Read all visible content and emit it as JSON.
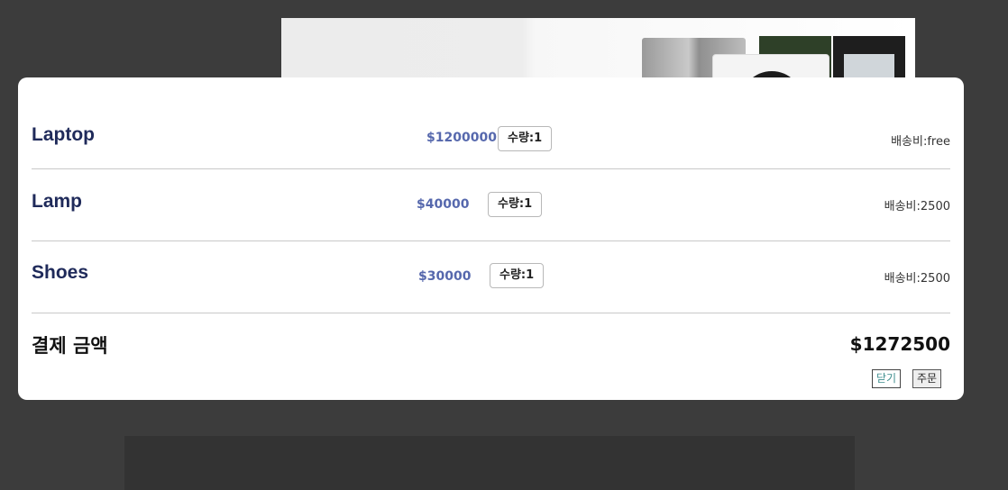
{
  "cart": {
    "items": [
      {
        "name": "Laptop",
        "price": "$1200000",
        "quantity": "수량:1",
        "shipping": "배송비:free"
      },
      {
        "name": "Lamp",
        "price": "$40000",
        "quantity": "수량:1",
        "shipping": "배송비:2500"
      },
      {
        "name": "Shoes",
        "price": "$30000",
        "quantity": "수량:1",
        "shipping": "배송비:2500"
      }
    ],
    "total_label": "결제 금액",
    "total_value": "$1272500",
    "close_label": "닫기",
    "order_label": "주문"
  },
  "colors": {
    "product_name": "#1f2a5a",
    "price": "#5668ad",
    "overlay_background": "#3c3c3c"
  }
}
